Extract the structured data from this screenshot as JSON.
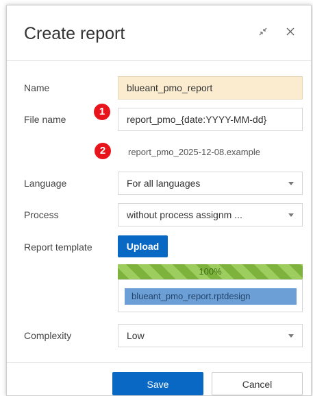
{
  "dialog": {
    "title": "Create report",
    "minimize_icon": "collapse-arrows-icon",
    "close_icon": "close-icon"
  },
  "form": {
    "name_label": "Name",
    "name_value": "blueant_pmo_report",
    "filename_label": "File name",
    "filename_value": "report_pmo_{date:YYYY-MM-dd}",
    "filename_preview": "report_pmo_2025-12-08.example",
    "language_label": "Language",
    "language_value": "For all languages",
    "process_label": "Process",
    "process_value": "without process assignm ...",
    "template_label": "Report template",
    "upload_label": "Upload",
    "upload_progress": "100%",
    "uploaded_file": "blueant_pmo_report.rptdesign",
    "complexity_label": "Complexity",
    "complexity_value": "Low"
  },
  "badges": [
    "1",
    "2"
  ],
  "footer": {
    "save_label": "Save",
    "cancel_label": "Cancel"
  },
  "colors": {
    "primary": "#0a68c5",
    "badge": "#e8141b",
    "name_highlight": "#fbeccf",
    "progress": "#8cc04f"
  }
}
